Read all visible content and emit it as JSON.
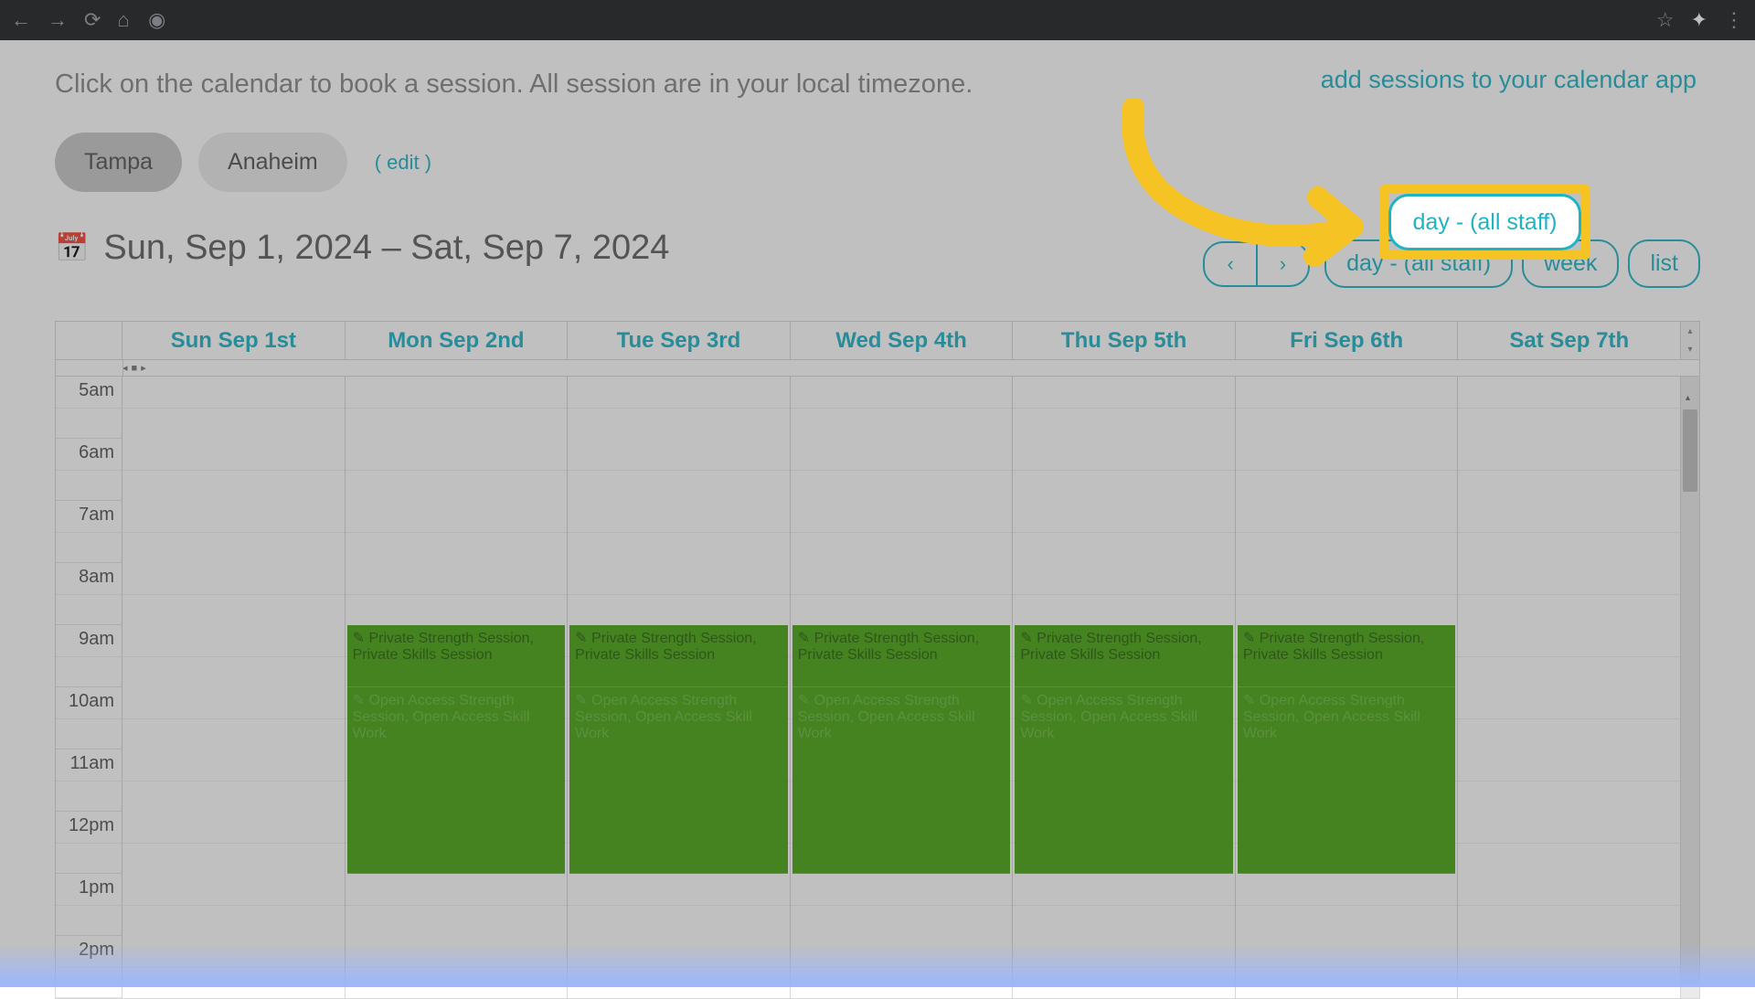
{
  "instruction_text": "Click on the calendar to book a session. All session are in your local timezone.",
  "top_link": "add sessions to your calendar app",
  "tabs": {
    "active": "Tampa",
    "inactive": "Anaheim",
    "edit": "( edit )"
  },
  "date_range": "Sun, Sep 1, 2024 – Sat, Sep 7, 2024",
  "view": {
    "day": "day - (all staff)",
    "week": "week",
    "list": "list"
  },
  "days": [
    "Sun Sep 1st",
    "Mon Sep 2nd",
    "Tue Sep 3rd",
    "Wed Sep 4th",
    "Thu Sep 5th",
    "Fri Sep 6th",
    "Sat Sep 7th"
  ],
  "times": [
    "5am",
    "6am",
    "7am",
    "8am",
    "9am",
    "10am",
    "11am",
    "12pm",
    "1pm",
    "2pm"
  ],
  "event_private_label": "Private Strength Session, Private Skills Session",
  "event_open_label": "Open Access Strength Session, Open Access Skill Work",
  "pencil_glyph": "✎",
  "nav_prev_glyph": "‹",
  "nav_next_glyph": "›",
  "mini_nav_left": "◂",
  "mini_nav_sq": "■",
  "mini_nav_right": "▸",
  "highlight_text": "day - (all staff)"
}
